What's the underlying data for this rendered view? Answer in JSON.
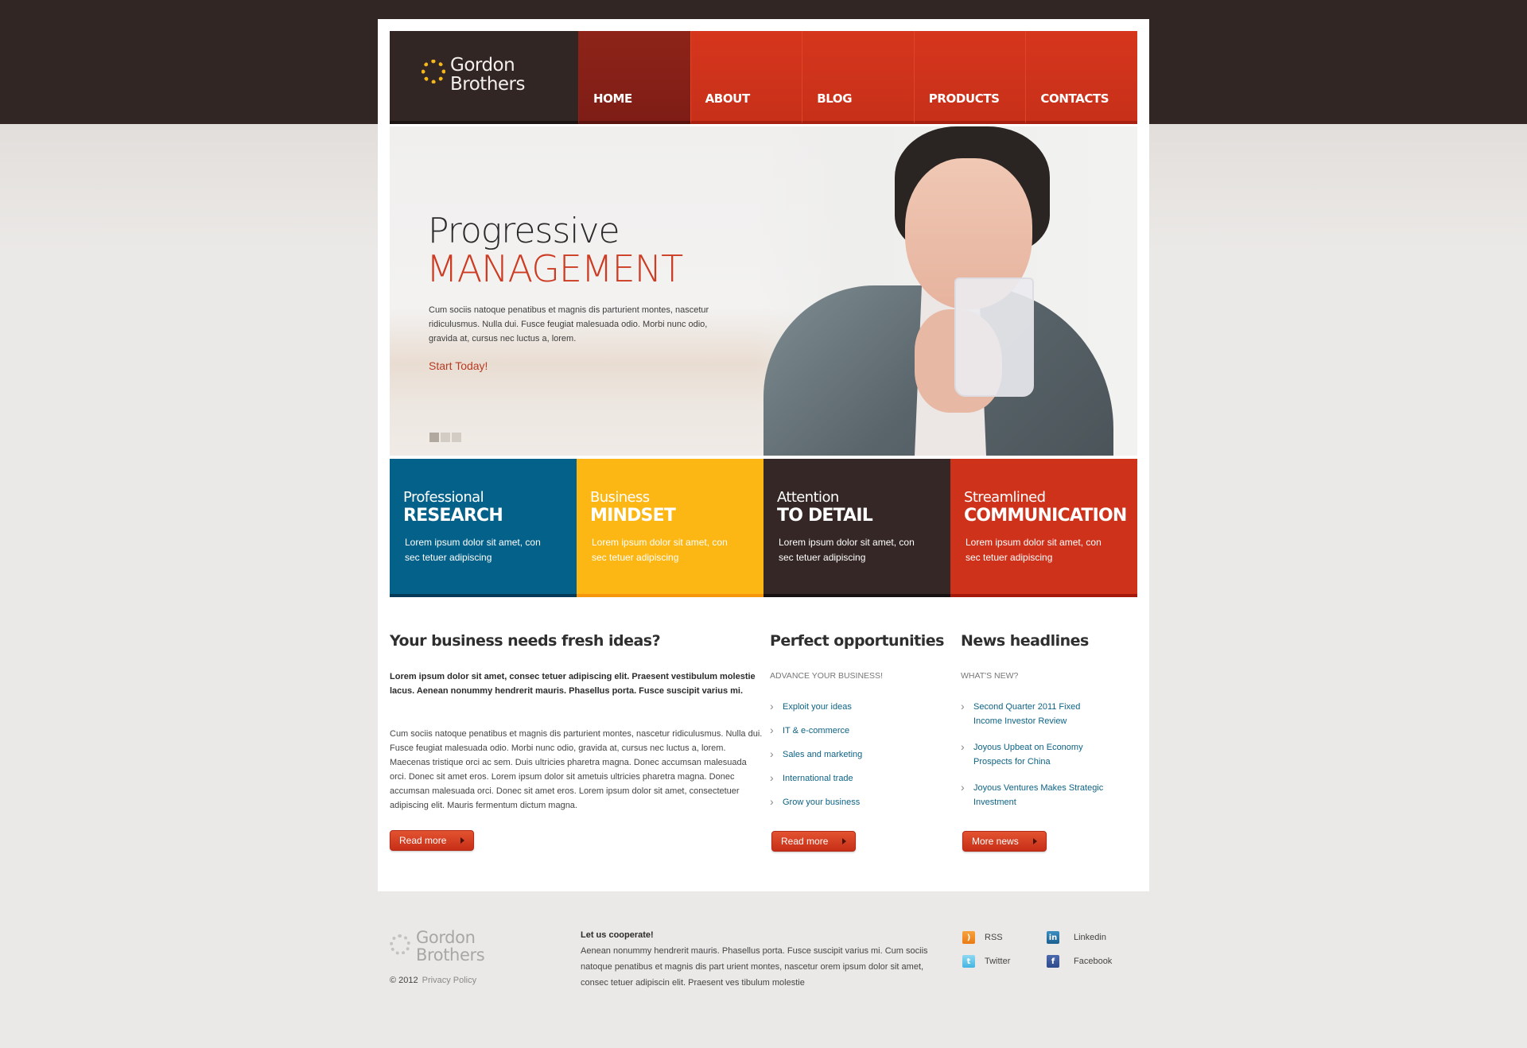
{
  "brand": {
    "line1": "Gordon",
    "line2": "Brothers"
  },
  "nav": {
    "items": [
      {
        "label": "HOME",
        "active": true
      },
      {
        "label": "ABOUT",
        "active": false
      },
      {
        "label": "BLOG",
        "active": false
      },
      {
        "label": "PRODUCTS",
        "active": false
      },
      {
        "label": "CONTACTS",
        "active": false
      }
    ]
  },
  "hero": {
    "title_line1": "Progressive",
    "title_line2": "MANAGEMENT",
    "text": "Cum sociis natoque penatibus et magnis dis parturient montes, nascetur ridiculusmus. Nulla dui. Fusce feugiat malesuada odio. Morbi nunc odio, gravida at, cursus nec luctus a, lorem.",
    "cta": "Start Today!",
    "slides_total": 3,
    "active_slide": 1
  },
  "features": [
    {
      "top": "Professional",
      "main": "RESEARCH",
      "text": "Lorem ipsum dolor sit amet, con sec tetuer adipiscing",
      "color": "#04628a"
    },
    {
      "top": "Business",
      "main": "MINDSET",
      "text": "Lorem ipsum dolor sit amet, con sec tetuer adipiscing",
      "color": "#fcb715"
    },
    {
      "top": "Attention",
      "main": "TO DETAIL",
      "text": "Lorem ipsum dolor sit amet, con sec tetuer adipiscing",
      "color": "#342725"
    },
    {
      "top": "Streamlined",
      "main": "COMMUNICATION",
      "text": "Lorem ipsum dolor sit amet, con sec tetuer adipiscing",
      "color": "#cf321b"
    }
  ],
  "fresh_ideas": {
    "title": "Your business needs fresh ideas?",
    "bold": "Lorem ipsum dolor sit amet, consec tetuer adipiscing elit. Praesent vestibulum molestie lacus. Aenean nonummy hendrerit mauris. Phasellus porta. Fusce suscipit varius mi.",
    "paragraph": "Cum sociis natoque penatibus et magnis dis parturient montes, nascetur ridiculusmus. Nulla dui. Fusce feugiat malesuada odio. Morbi nunc odio, gravida at, cursus nec luctus a, lorem. Maecenas tristique orci ac sem. Duis ultricies pharetra magna. Donec accumsan malesuada orci. Donec sit amet eros. Lorem ipsum dolor sit ametuis ultricies pharetra magna. Donec accumsan malesuada orci. Donec sit amet eros. Lorem ipsum dolor sit amet, consectetuer adipiscing elit. Mauris fermentum dictum magna.",
    "button": "Read more"
  },
  "opportunities": {
    "title": "Perfect opportunities",
    "subtitle": "ADVANCE YOUR BUSINESS!",
    "items": [
      "Exploit your ideas",
      "IT & e-commerce",
      "Sales and marketing",
      "International trade",
      "Grow your business"
    ],
    "button": "Read more"
  },
  "news": {
    "title": "News headlines",
    "subtitle": "WHAT'S NEW?",
    "items": [
      "Second Quarter 2011 Fixed Income Investor Review",
      "Joyous Upbeat on Economy Prospects for China",
      "Joyous Ventures Makes Strategic Investment"
    ],
    "button": "More news"
  },
  "footer": {
    "brand": {
      "line1": "Gordon",
      "line2": "Brothers"
    },
    "copyright": "© 2012",
    "privacy": "Privacy Policy",
    "coop_title": "Let us cooperate!",
    "coop_text": "Aenean nonummy hendrerit mauris. Phasellus porta. Fusce suscipit varius mi. Cum sociis natoque penatibus et magnis dis part urient montes, nascetur orem ipsum dolor sit amet, consec tetuer adipiscin elit. Praesent ves tibulum molestie",
    "social": [
      {
        "label": "RSS",
        "icon": "rss-icon"
      },
      {
        "label": "Linkedin",
        "icon": "linkedin-icon"
      },
      {
        "label": "Twitter",
        "icon": "twitter-icon"
      },
      {
        "label": "Facebook",
        "icon": "facebook-icon"
      }
    ]
  }
}
